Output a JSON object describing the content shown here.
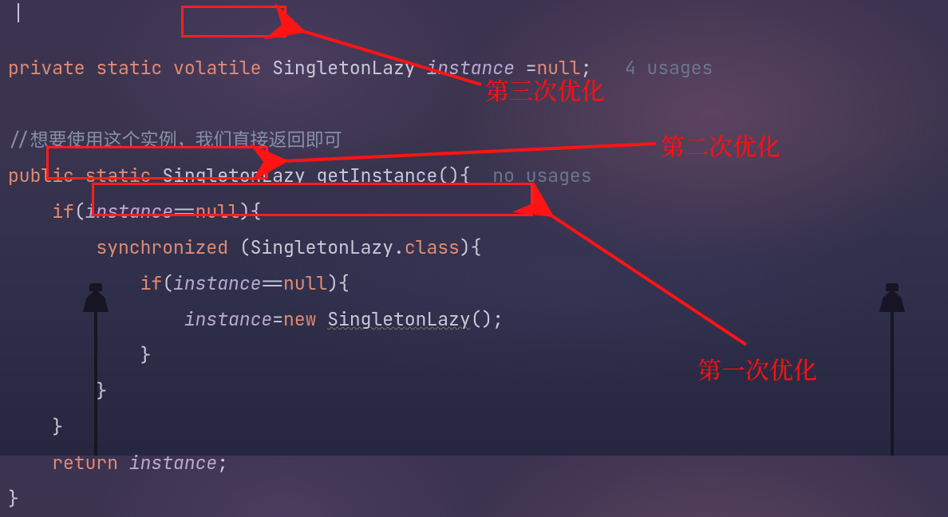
{
  "code": {
    "line1": {
      "kw_private": "private",
      "kw_static": "static",
      "kw_volatile": "volatile",
      "type": "SingletonLazy",
      "ident": "instance",
      "eq": " =",
      "null": "null",
      "semi": ";",
      "usages": "4 usages"
    },
    "comment": "//想要使用这个实例，我们直接返回即可",
    "line3": {
      "kw_public": "public",
      "kw_static": "static",
      "type": "SingletonLazy",
      "method": "getInstance",
      "parens": "(){",
      "usages": "no usages"
    },
    "line4": {
      "kw_if": "if",
      "open": "(",
      "ident": "instance",
      "eqnull": "==",
      "null": "null",
      "close": "){"
    },
    "line5": {
      "kw_sync": "synchronized",
      "open": " (",
      "type": "SingletonLazy",
      "dotclass": ".",
      "kw_class": "class",
      "close": "){"
    },
    "line6": {
      "kw_if": "if",
      "open": "(",
      "ident": "instance",
      "eqnull": "==",
      "null": "null",
      "close": "){"
    },
    "line7": {
      "ident": "instance",
      "eq": "=",
      "kw_new": "new",
      "ctor": "SingletonLazy",
      "tail": "();"
    },
    "line8": "}",
    "line9": "}",
    "line10": "}",
    "line11": {
      "kw_return": "return",
      "ident": "instance",
      "semi": ";"
    },
    "line12": "}"
  },
  "annotations": {
    "a3": "第三次优化",
    "a2": "第二次优化",
    "a1": "第一次优化"
  }
}
